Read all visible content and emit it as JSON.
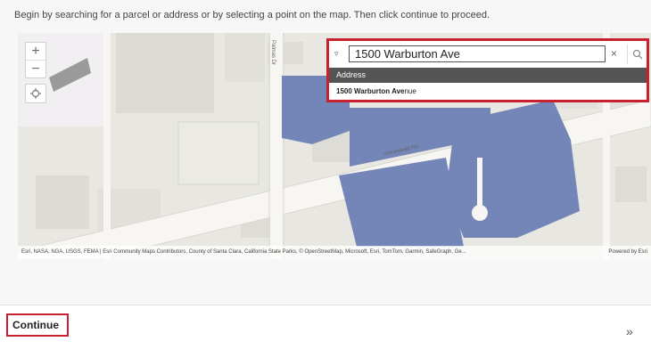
{
  "instructions": "Begin by searching for a parcel or address or by selecting a point on the map. Then click continue to proceed.",
  "map": {
    "zoom_in_label": "+",
    "zoom_out_label": "−",
    "street_labels": [
      "Homestead Rd",
      "Palmas Dr"
    ],
    "attribution_left": "Esri, NASA, NGA, USGS, FEMA | Esri Community Maps Contributors, County of Santa Clara, California State Parks, © OpenStreetMap, Microsoft, Esri, TomTom, Garmin, SafeGraph, Ge...",
    "attribution_right": "Powered by Esri",
    "parcel_color": "#7485b8"
  },
  "search": {
    "value": "1500 Warburton Ave",
    "group_header": "Address",
    "suggestion_bold": "1500 Warburton Ave",
    "suggestion_rest": "nue",
    "clear_label": "×",
    "highlight_color": "#c8202f"
  },
  "footer": {
    "continue_label": "Continue",
    "next_label": "»"
  }
}
